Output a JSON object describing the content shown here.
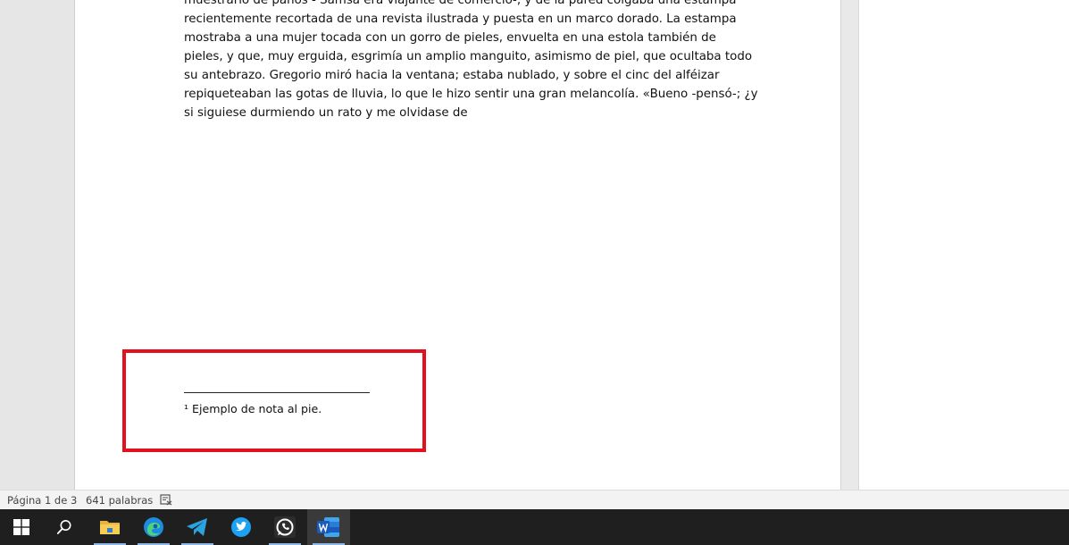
{
  "document": {
    "body_lines": [
      "muestrario de paños - Samsa era viajante de comercio-, y de la pared colgaba una estampa",
      "recientemente recortada de una revista ilustrada y puesta en un marco dorado. La estampa",
      "mostraba a una mujer tocada con un gorro de pieles, envuelta en una estola también de",
      "pieles, y que, muy erguida, esgrimía un amplio manguito, asimismo de piel, que ocultaba todo",
      "su antebrazo. Gregorio miró hacia la ventana; estaba nublado, y sobre el cinc del alféizar",
      "repiqueteaban las gotas de lluvia, lo que le hizo sentir una gran melancolía. «Bueno -pensó-; ¿y",
      "si siguiese durmiendo un rato y me olvidase de"
    ],
    "footnote": "¹ Ejemplo de nota al pie."
  },
  "status_bar": {
    "page_info": "Página 1 de 3",
    "word_count": "641 palabras",
    "proofing_icon": "proofing-icon"
  },
  "taskbar": {
    "items": [
      {
        "name": "start-button",
        "icon": "windows-logo-icon"
      },
      {
        "name": "search-button",
        "icon": "search-icon"
      },
      {
        "name": "file-explorer",
        "icon": "folder-icon"
      },
      {
        "name": "edge",
        "icon": "edge-icon"
      },
      {
        "name": "telegram",
        "icon": "telegram-icon"
      },
      {
        "name": "twitter",
        "icon": "twitter-icon"
      },
      {
        "name": "whatsapp",
        "icon": "whatsapp-icon"
      },
      {
        "name": "word",
        "icon": "word-icon"
      }
    ]
  },
  "colors": {
    "highlight_border": "#e3111d",
    "taskbar_bg": "#1f1f1f",
    "word_blue": "#2b579a"
  }
}
